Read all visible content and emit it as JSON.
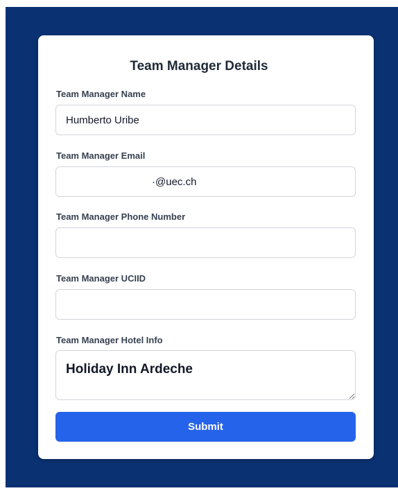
{
  "form": {
    "title": "Team Manager Details",
    "fields": [
      {
        "label": "Team Manager Name",
        "value": "Humberto Uribe",
        "placeholder": ""
      },
      {
        "label": "Team Manager Email",
        "value": "·@uec.ch",
        "placeholder": ""
      },
      {
        "label": "Team Manager Phone Number",
        "value": "",
        "placeholder": ""
      },
      {
        "label": "Team Manager UCIID",
        "value": "",
        "placeholder": ""
      },
      {
        "label": "Team Manager Hotel Info",
        "value": "Holiday Inn Ardeche",
        "placeholder": ""
      }
    ],
    "submit_label": "Submit"
  },
  "colors": {
    "backdrop": "#0a3172",
    "card": "#ffffff",
    "submit_button": "#2563eb"
  }
}
